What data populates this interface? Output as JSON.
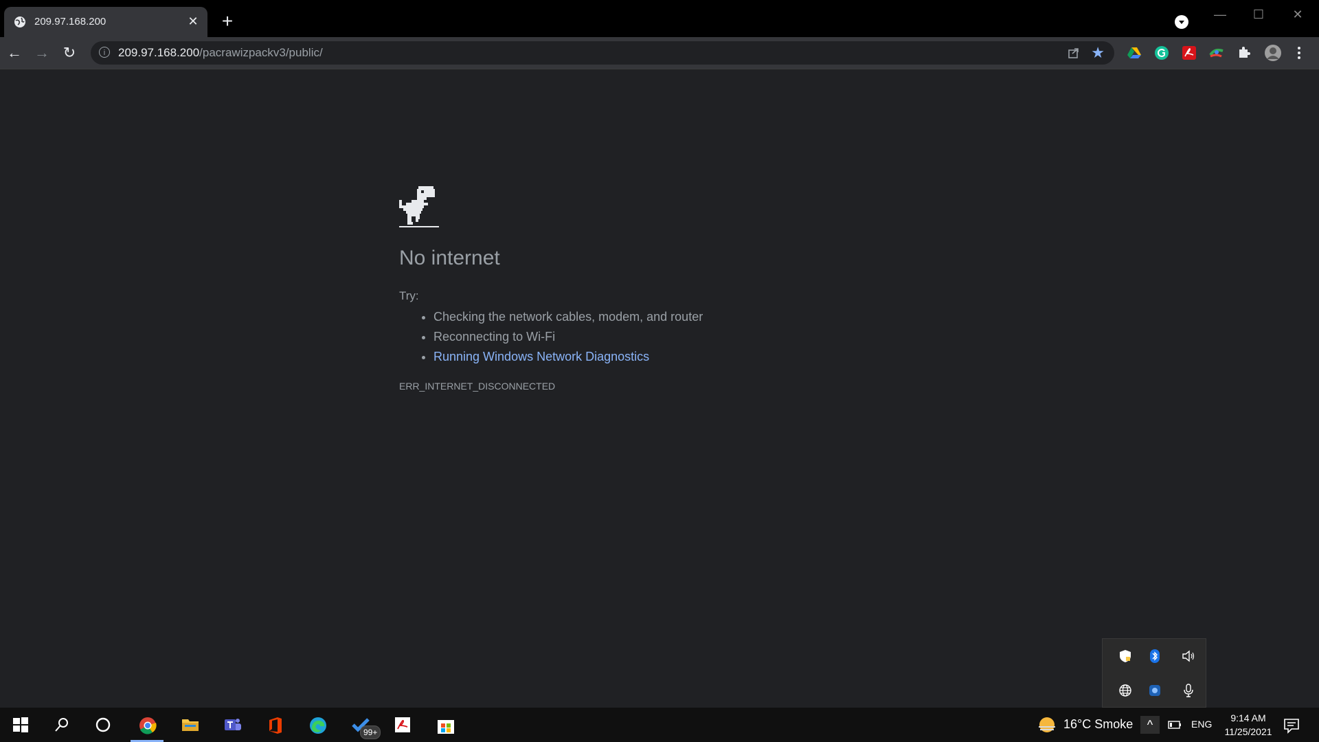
{
  "tab": {
    "title": "209.97.168.200",
    "close": "✕",
    "new_tab": "+"
  },
  "window_controls": {
    "minimize": "—",
    "maximize": "☐",
    "close": "✕"
  },
  "toolbar": {
    "back": "←",
    "forward": "→",
    "reload": "↻",
    "url_host": "209.97.168.200",
    "url_path": "/pacrawizpackv3/public/",
    "info": "i",
    "star": "★",
    "extensions": [
      "google-drive-icon",
      "grammarly-icon",
      "adobe-acrobat-icon",
      "color-extension-icon",
      "puzzle-extensions-icon",
      "profile-avatar",
      "more-menu-icon"
    ]
  },
  "page": {
    "heading": "No internet",
    "try_label": "Try:",
    "suggestions": [
      "Checking the network cables, modem, and router",
      "Reconnecting to Wi-Fi",
      "Running Windows Network Diagnostics"
    ],
    "error_code": "ERR_INTERNET_DISCONNECTED"
  },
  "tray_flyout": {
    "icons": [
      "windows-security-icon",
      "bluetooth-icon",
      "volume-icon",
      "globe-icon",
      "onedrive-icon",
      "microphone-icon"
    ]
  },
  "taskbar": {
    "apps": [
      "start-icon",
      "search-icon",
      "cortana-icon",
      "chrome-icon",
      "file-explorer-icon",
      "teams-icon",
      "office-icon",
      "edge-icon",
      "todo-icon",
      "acrobat-icon",
      "store-icon"
    ],
    "todo_badge": "99+",
    "weather": "16°C  Smoke",
    "chevron": "^",
    "language": "ENG",
    "time": "9:14 AM",
    "date": "11/25/2021"
  },
  "colors": {
    "background": "#202124",
    "link": "#8ab4f8",
    "text": "#9aa0a6"
  }
}
